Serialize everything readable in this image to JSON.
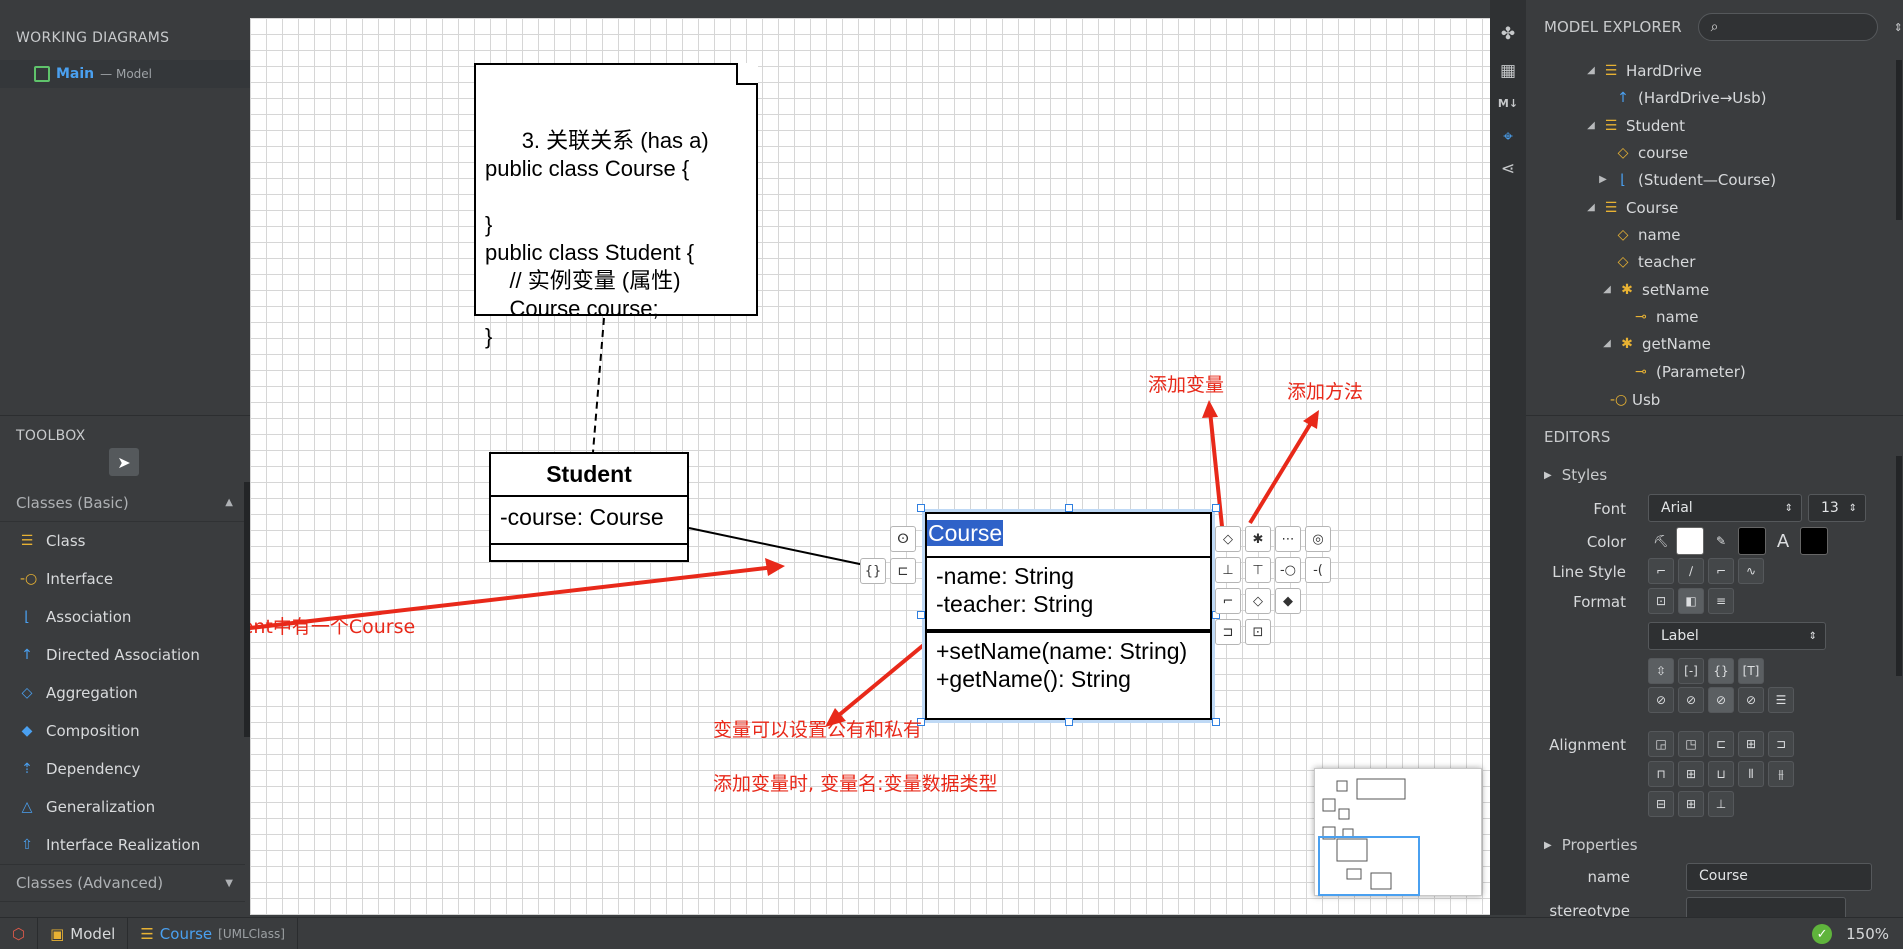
{
  "working_diagrams": {
    "title": "WORKING DIAGRAMS",
    "item": {
      "name": "Main",
      "sub": "— Model"
    }
  },
  "toolbox": {
    "title": "TOOLBOX",
    "section_basic": "Classes (Basic)",
    "items": [
      "Class",
      "Interface",
      "Association",
      "Directed Association",
      "Aggregation",
      "Composition",
      "Dependency",
      "Generalization",
      "Interface Realization"
    ],
    "section_advanced": "Classes (Advanced)"
  },
  "canvas": {
    "note_text": "3. 关联关系 (has a)\npublic class Course {\n\n}\npublic class Student {\n    // 实例变量 (属性)\n    Course course;\n}",
    "student": {
      "name": "Student",
      "attr": "-course: Course"
    },
    "course": {
      "name": "Course",
      "attrs": [
        "-name: String",
        "-teacher: String"
      ],
      "ops": [
        "+setName(name: String)",
        "+getName(): String"
      ]
    },
    "annotations": {
      "add_attr": "添加变量",
      "add_method": "添加方法",
      "association": "关联, Student中有一个Course",
      "visibility": "变量可以设置公有和私有",
      "attr_format": "添加变量时, 变量名:变量数据类型"
    }
  },
  "explorer": {
    "title": "MODEL EXPLORER",
    "search_placeholder": "",
    "rows": [
      {
        "label": "HardDrive"
      },
      {
        "label": "(HardDrive→Usb)"
      },
      {
        "label": "Student"
      },
      {
        "label": "course"
      },
      {
        "label": "(Student—Course)"
      },
      {
        "label": "Course"
      },
      {
        "label": "name"
      },
      {
        "label": "teacher"
      },
      {
        "label": "setName"
      },
      {
        "label": "name"
      },
      {
        "label": "getName"
      },
      {
        "label": "(Parameter)"
      },
      {
        "label": "Usb"
      }
    ]
  },
  "editors": {
    "title": "EDITORS",
    "styles": "Styles",
    "font_label": "Font",
    "font_value": "Arial",
    "font_size": "13",
    "color_label": "Color",
    "line_style_label": "Line Style",
    "format_label": "Format",
    "format_value": "Label",
    "alignment_label": "Alignment",
    "properties": "Properties",
    "name_label": "name",
    "name_value": "Course",
    "stereotype_label": "stereotype"
  },
  "status": {
    "model": "Model",
    "selection": "Course",
    "selection_type": "[UMLClass]",
    "zoom": "150%"
  },
  "colors": {
    "accent": "#4aa0f0",
    "annotation_red": "#e8291a",
    "class_icon": "#e8b233",
    "selection": "#2f62c8"
  }
}
